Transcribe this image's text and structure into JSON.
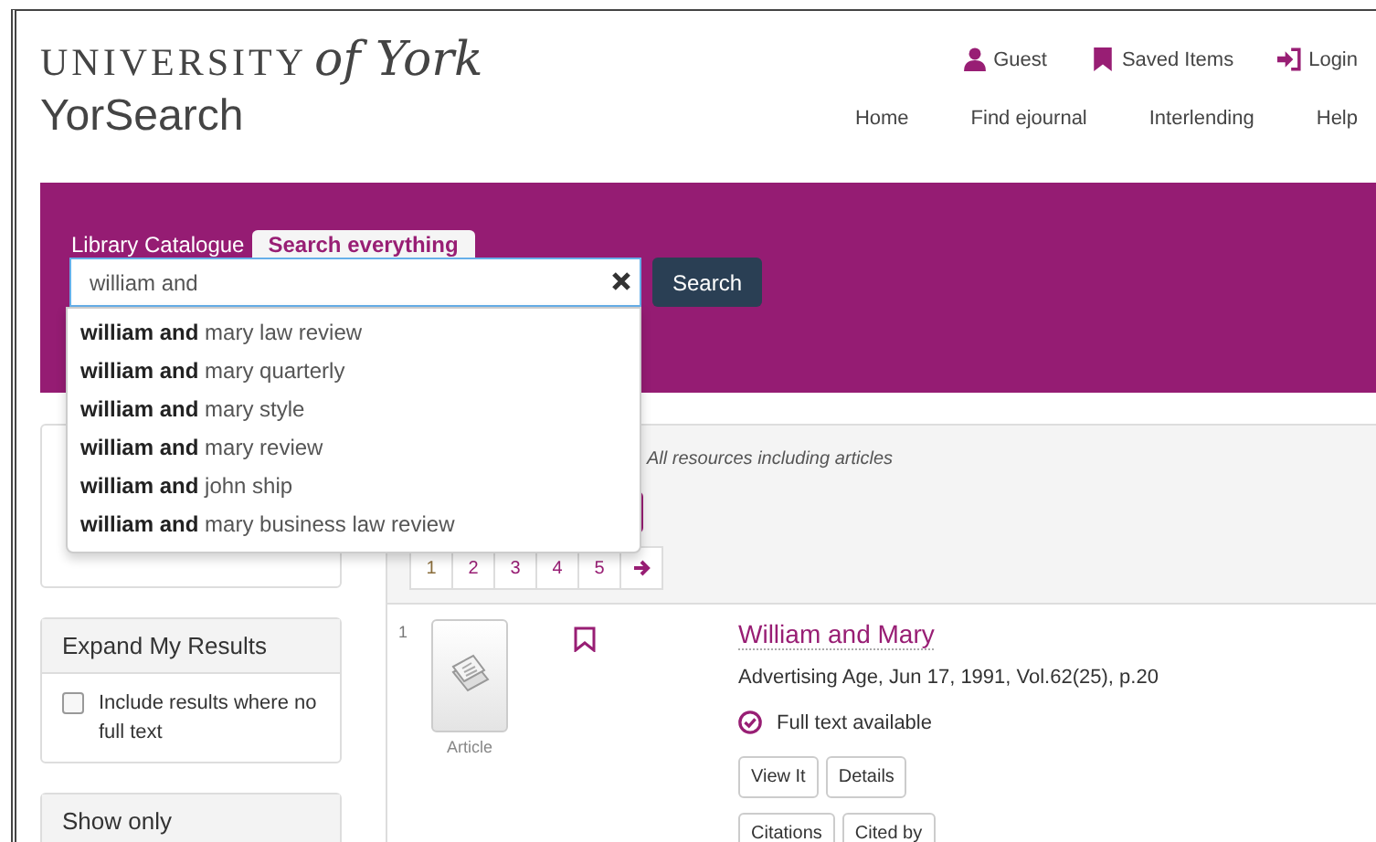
{
  "header": {
    "logo": {
      "wordmark": "UNIVERSITY",
      "script": "of York"
    },
    "app_title": "YorSearch",
    "user_links": [
      {
        "label": "Guest",
        "kind": "person"
      },
      {
        "label": "Saved Items",
        "kind": "saved"
      },
      {
        "label": "Login",
        "kind": "login"
      }
    ],
    "nav": [
      "Home",
      "Find ejournal",
      "Interlending",
      "Help"
    ]
  },
  "search": {
    "tabs": [
      {
        "label": "Library Catalogue",
        "selected": false
      },
      {
        "label": "Search everything",
        "selected": true
      }
    ],
    "value": "william and",
    "button": "Search",
    "suggestions": [
      "**william and** mary law review",
      "**william and** mary quarterly",
      "**william and** mary style",
      "**william and** mary review",
      "**william and** john ship",
      "**william and** mary business law review"
    ]
  },
  "sidebar": [
    {
      "title": "Expand My Results",
      "options": [
        {
          "label": "Include results where no full text",
          "checked": false
        }
      ]
    },
    {
      "title": "Show only"
    }
  ],
  "scope_note": "All resources including articles",
  "pagination": [
    {
      "label": "1",
      "selected": true
    },
    {
      "label": "2",
      "selected": false
    },
    {
      "label": "3",
      "selected": false
    },
    {
      "label": "4",
      "selected": false
    },
    {
      "label": "5",
      "selected": false
    }
  ],
  "results": [
    {
      "number": "1",
      "type": "Article",
      "saved": false,
      "title": "William and Mary",
      "citation": "Advertising Age, Jun 17, 1991, Vol.62(25), p.20",
      "availability": "Full text available",
      "buttons": [
        "View It",
        "Details",
        "Citations",
        "Cited by"
      ]
    }
  ]
}
